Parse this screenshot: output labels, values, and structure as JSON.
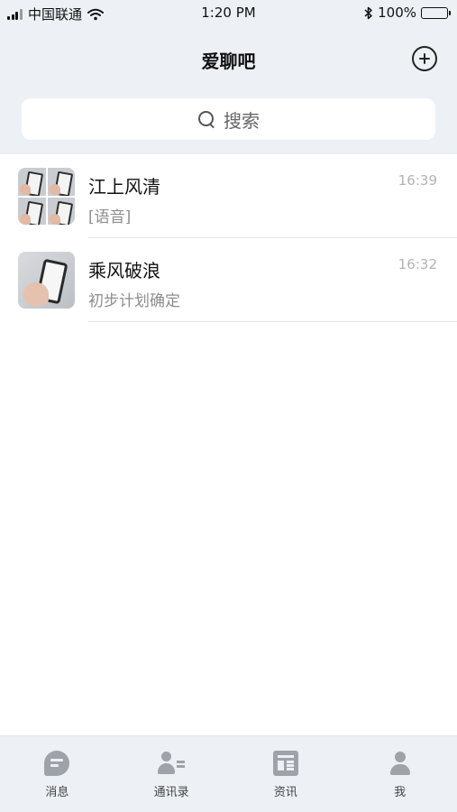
{
  "status_bar": {
    "carrier": "中国联通",
    "time": "1:20 PM",
    "battery": "100%",
    "icons": [
      "signal-icon",
      "wifi-icon",
      "bluetooth-icon",
      "battery-icon"
    ]
  },
  "nav": {
    "title": "爱聊吧",
    "add_icon": "plus-circle-icon"
  },
  "search": {
    "placeholder": "搜索",
    "icon": "search-icon"
  },
  "conversations": [
    {
      "name": "江上风清",
      "preview": "[语音]",
      "time": "16:39",
      "avatar": "group-avatar-grid"
    },
    {
      "name": "乘风破浪",
      "preview": "初步计划确定",
      "time": "16:32",
      "avatar": "phone-photo-avatar"
    }
  ],
  "tabs": [
    {
      "label": "消息",
      "icon": "message-icon"
    },
    {
      "label": "通讯录",
      "icon": "contacts-icon"
    },
    {
      "label": "资讯",
      "icon": "news-icon"
    },
    {
      "label": "我",
      "icon": "profile-icon"
    }
  ],
  "colors": {
    "header_bg": "#edf0f5",
    "tab_icon": "#9ea3a9",
    "time_text": "#b3b3b3",
    "preview_text": "#8e8e8e"
  }
}
